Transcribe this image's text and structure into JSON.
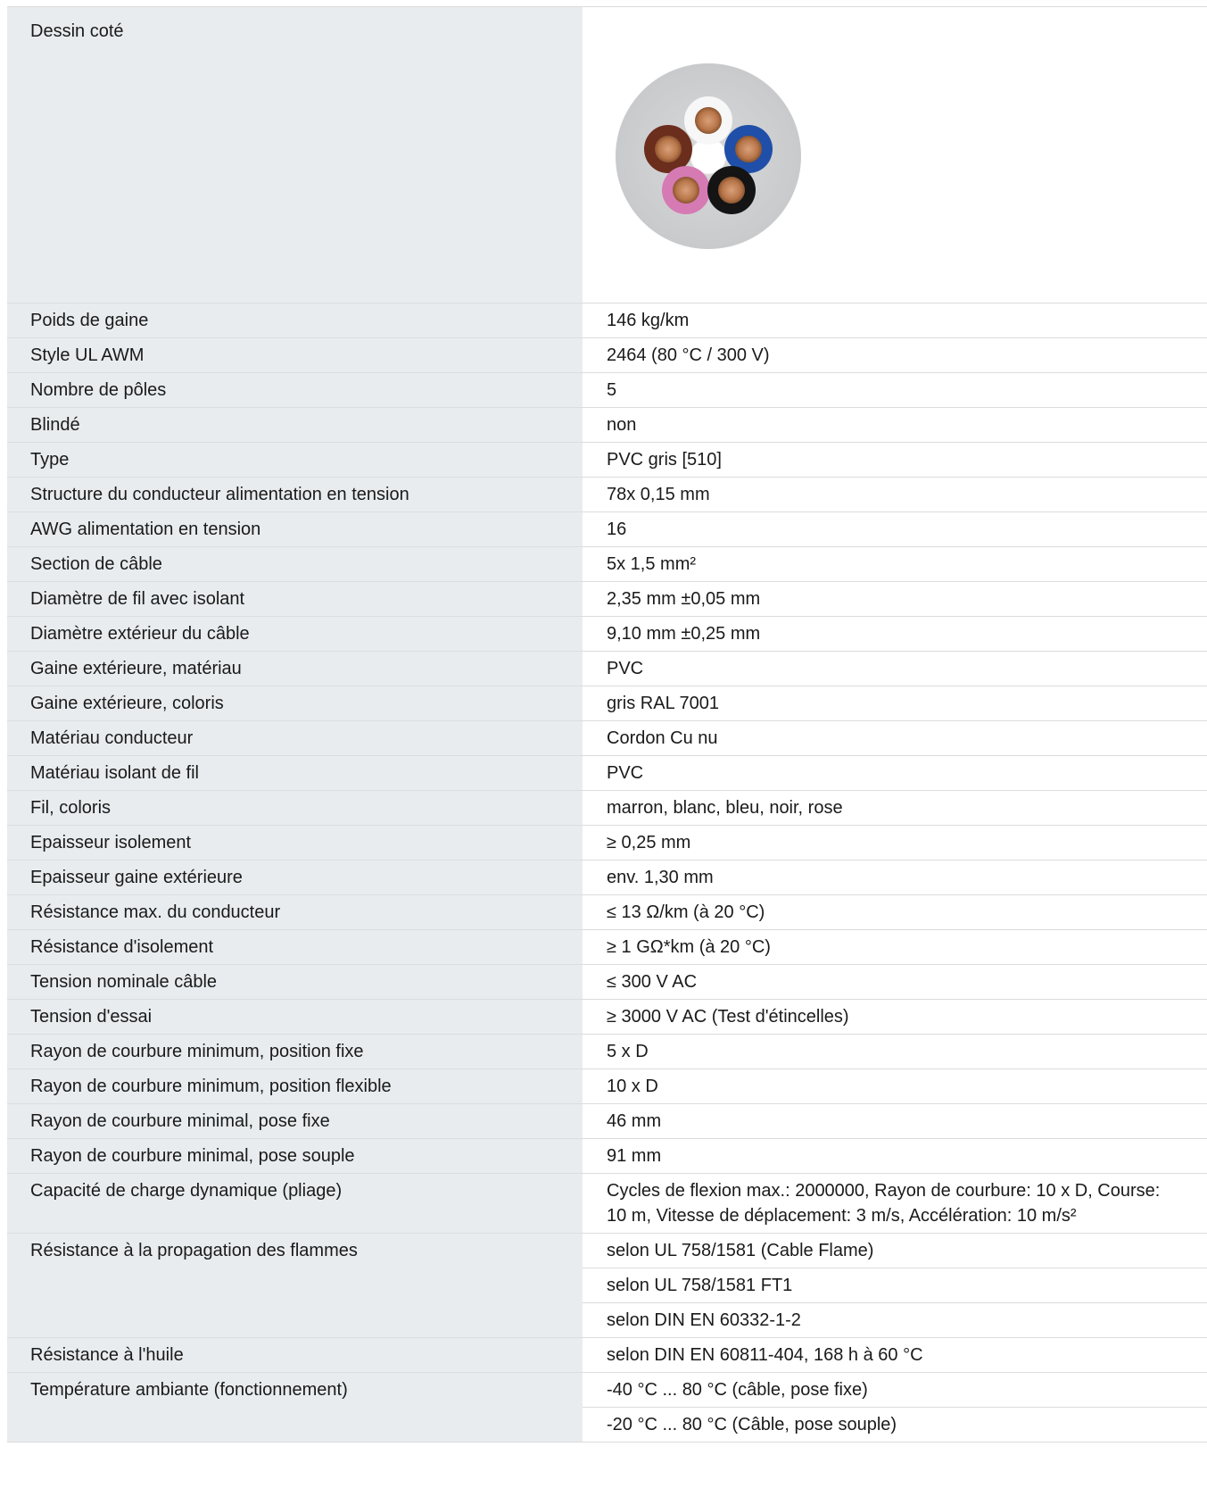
{
  "drawing": {
    "label": "Dessin coté",
    "cable_icon": "cable-cross-section-icon",
    "conductor_colors": [
      "marron",
      "blanc",
      "bleu",
      "noir",
      "rose"
    ]
  },
  "rows": [
    {
      "label": "Poids de gaine",
      "values": [
        "146 kg/km"
      ]
    },
    {
      "label": "Style UL AWM",
      "values": [
        "2464 (80 °C / 300 V)"
      ]
    },
    {
      "label": "Nombre de pôles",
      "values": [
        "5"
      ]
    },
    {
      "label": "Blindé",
      "values": [
        "non"
      ]
    },
    {
      "label": "Type",
      "values": [
        "PVC gris [510]"
      ]
    },
    {
      "label": "Structure du conducteur alimentation en tension",
      "values": [
        "78x 0,15 mm"
      ]
    },
    {
      "label": "AWG alimentation en tension",
      "values": [
        "16"
      ]
    },
    {
      "label": "Section de câble",
      "values": [
        "5x 1,5 mm²"
      ]
    },
    {
      "label": "Diamètre de fil avec isolant",
      "values": [
        "2,35 mm ±0,05 mm"
      ]
    },
    {
      "label": "Diamètre extérieur du câble",
      "values": [
        "9,10 mm ±0,25 mm"
      ]
    },
    {
      "label": "Gaine extérieure, matériau",
      "values": [
        "PVC"
      ]
    },
    {
      "label": "Gaine extérieure, coloris",
      "values": [
        "gris RAL 7001"
      ]
    },
    {
      "label": "Matériau conducteur",
      "values": [
        "Cordon Cu nu"
      ]
    },
    {
      "label": "Matériau isolant de fil",
      "values": [
        "PVC"
      ]
    },
    {
      "label": "Fil, coloris",
      "values": [
        "marron, blanc, bleu, noir, rose"
      ]
    },
    {
      "label": "Epaisseur isolement",
      "values": [
        "≥ 0,25 mm"
      ]
    },
    {
      "label": "Epaisseur gaine extérieure",
      "values": [
        "env. 1,30 mm"
      ]
    },
    {
      "label": "Résistance max. du conducteur",
      "values": [
        "≤ 13 Ω/km (à 20 °C)"
      ]
    },
    {
      "label": "Résistance d'isolement",
      "values": [
        "≥ 1 GΩ*km (à 20 °C)"
      ]
    },
    {
      "label": "Tension nominale câble",
      "values": [
        "≤ 300 V AC"
      ]
    },
    {
      "label": "Tension d'essai",
      "values": [
        "≥ 3000 V AC (Test d'étincelles)"
      ]
    },
    {
      "label": "Rayon de courbure minimum, position fixe",
      "values": [
        "5 x D"
      ]
    },
    {
      "label": "Rayon de courbure minimum, position flexible",
      "values": [
        "10 x D"
      ]
    },
    {
      "label": "Rayon de courbure minimal, pose fixe",
      "values": [
        "46 mm"
      ]
    },
    {
      "label": "Rayon de courbure minimal, pose souple",
      "values": [
        "91 mm"
      ]
    },
    {
      "label": "Capacité de charge dynamique (pliage)",
      "values": [
        "Cycles de flexion max.: 2000000, Rayon de courbure: 10 x D, Course: 10 m, Vitesse de déplacement: 3 m/s, Accélération: 10 m/s²"
      ]
    },
    {
      "label": "Résistance à la propagation des flammes",
      "values": [
        "selon UL 758/1581 (Cable Flame)",
        "selon UL 758/1581 FT1",
        "selon DIN EN 60332-1-2"
      ]
    },
    {
      "label": "Résistance à l'huile",
      "values": [
        "selon DIN EN 60811-404, 168 h à 60 °C"
      ]
    },
    {
      "label": "Température ambiante (fonctionnement)",
      "values": [
        "-40 °C ... 80 °C (câble, pose fixe)",
        "-20 °C ... 80 °C (Câble, pose souple)"
      ]
    }
  ]
}
